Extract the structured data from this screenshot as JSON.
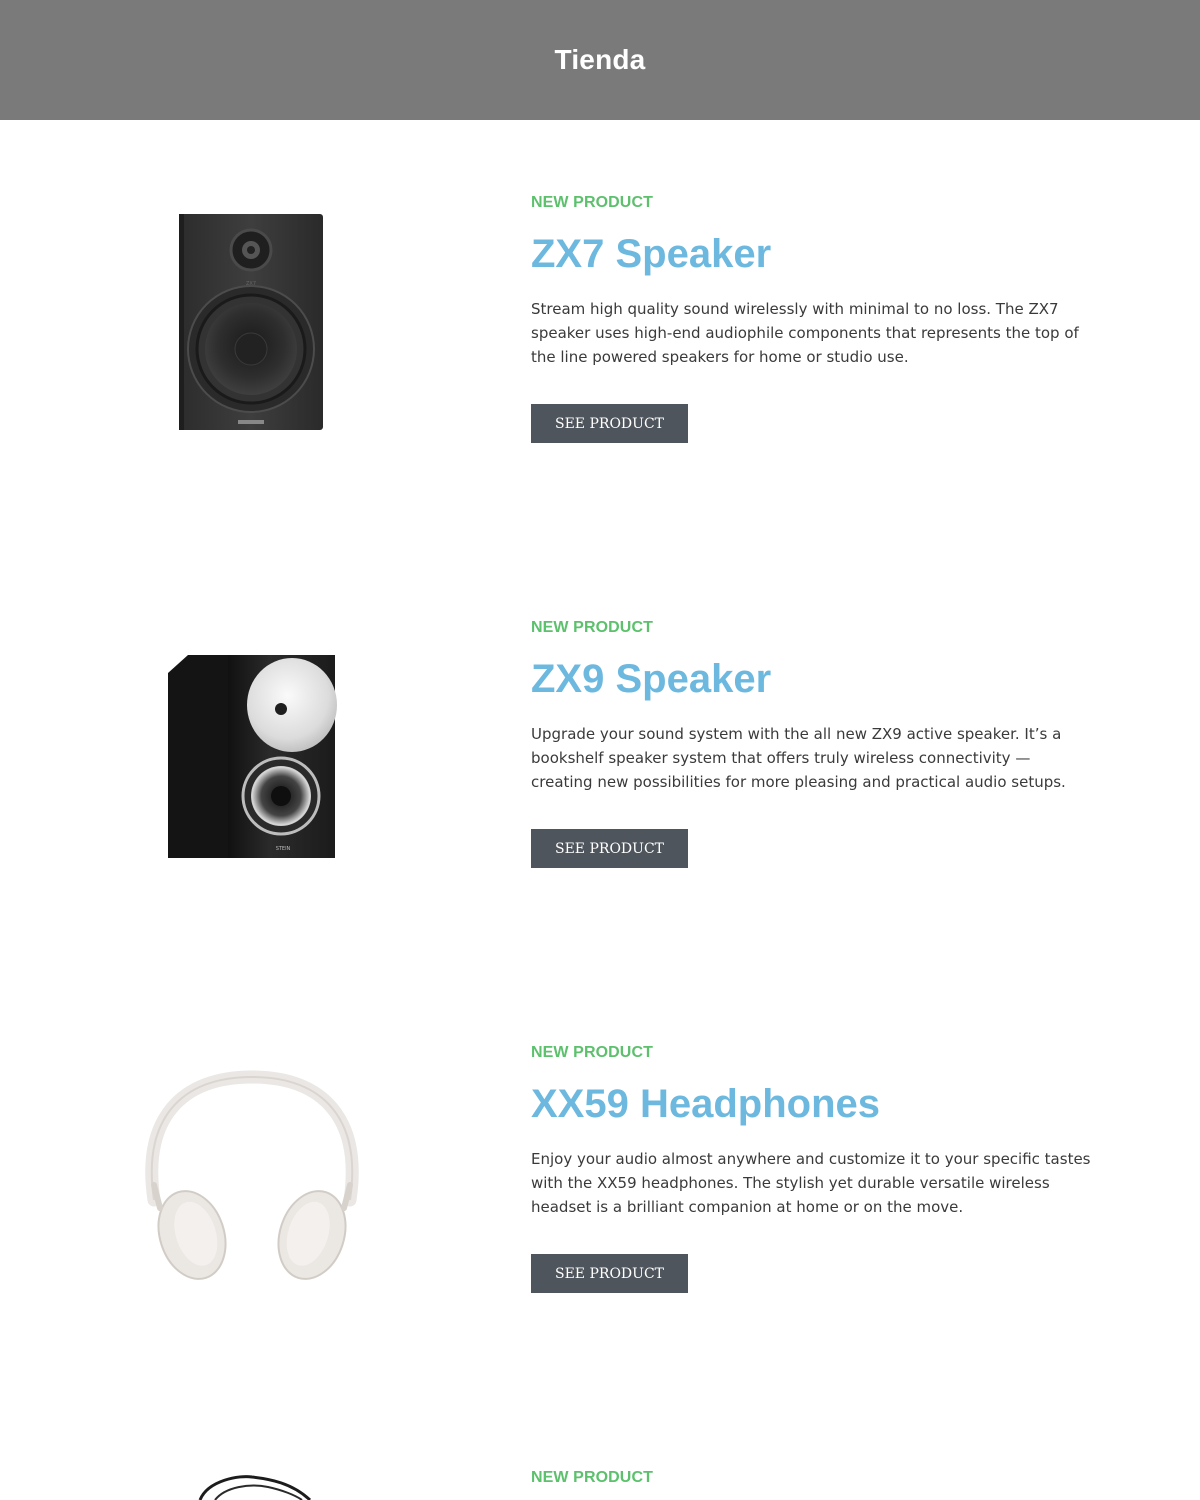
{
  "header": {
    "title": "Tienda"
  },
  "products": [
    {
      "tag": "NEW PRODUCT",
      "name": "ZX7 Speaker",
      "description": "Stream high quality sound wirelessly with minimal to no loss. The ZX7 speaker uses high-end audiophile components that represents the top of the line powered speakers for home or studio use.",
      "button_label": "SEE PRODUCT",
      "image_icon": "speaker-icon"
    },
    {
      "tag": "NEW PRODUCT",
      "name": "ZX9 Speaker",
      "description": "Upgrade your sound system with the all new ZX9 active speaker. It’s a bookshelf speaker system that offers truly wireless connectivity — creating new possibilities for more pleasing and practical audio setups.",
      "button_label": "SEE PRODUCT",
      "image_icon": "horn-speaker-icon"
    },
    {
      "tag": "NEW PRODUCT",
      "name": "XX59 Headphones",
      "description": "Enjoy your audio almost anywhere and customize it to your specific tastes with the XX59 headphones. The stylish yet durable versatile wireless headset is a brilliant companion at home or on the move.",
      "button_label": "SEE PRODUCT",
      "image_icon": "headphones-icon"
    },
    {
      "tag": "NEW PRODUCT",
      "image_icon": "earphones-icon"
    }
  ],
  "colors": {
    "header_bg": "#7a7a7a",
    "tag": "#5cc06d",
    "title": "#6cb8df",
    "button_bg": "#4f555c"
  }
}
